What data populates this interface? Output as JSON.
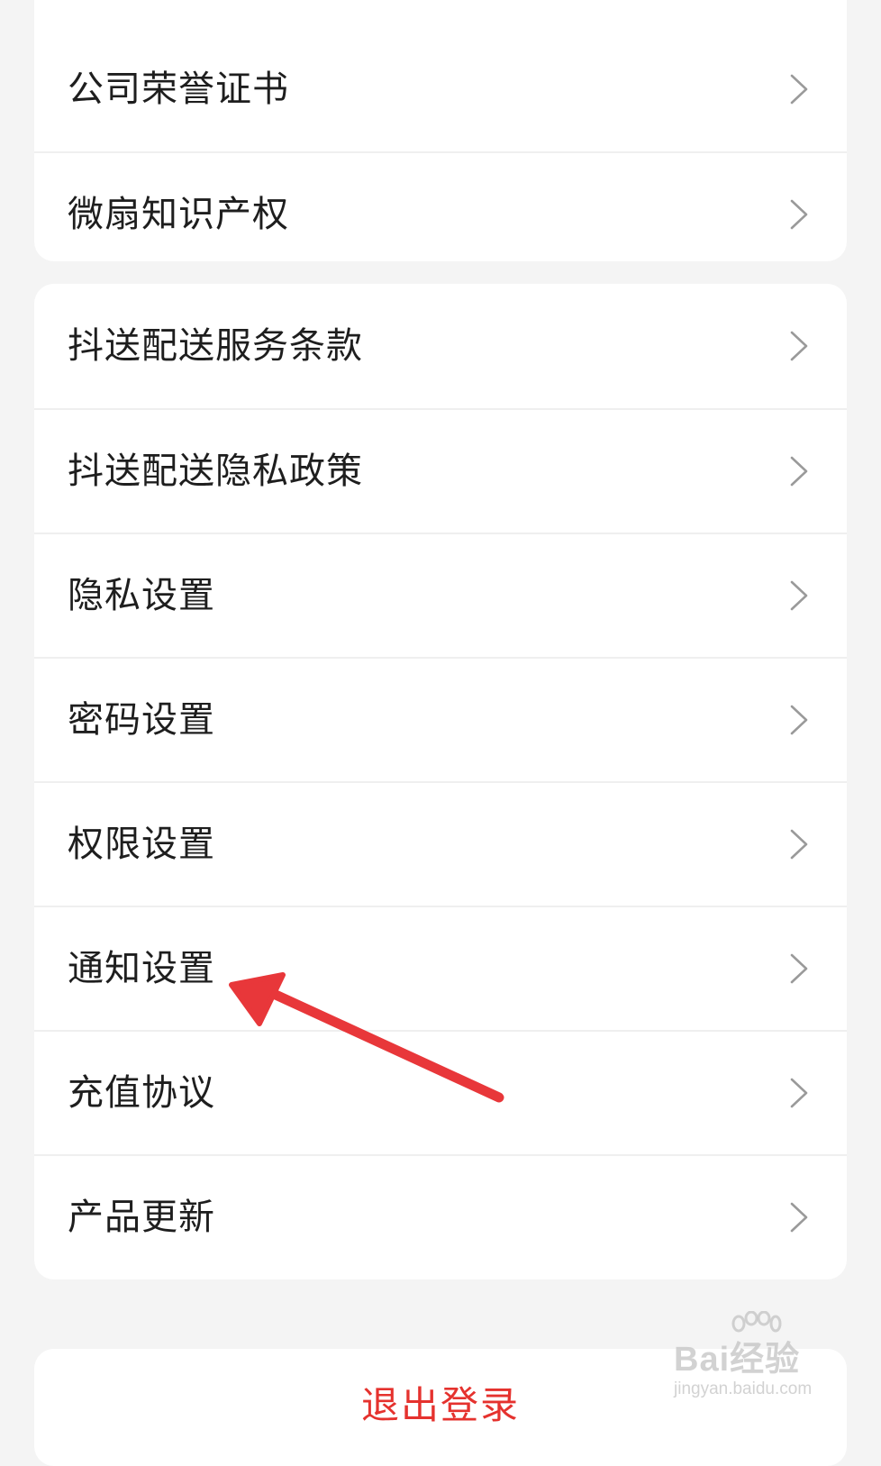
{
  "group_top": {
    "items": [
      {
        "label": "公司荣誉证书"
      },
      {
        "label": "微扇知识产权"
      }
    ]
  },
  "group_mid": {
    "items": [
      {
        "label": "抖送配送服务条款"
      },
      {
        "label": "抖送配送隐私政策"
      },
      {
        "label": "隐私设置"
      },
      {
        "label": "密码设置"
      },
      {
        "label": "权限设置"
      },
      {
        "label": "通知设置"
      },
      {
        "label": "充值协议"
      },
      {
        "label": "产品更新"
      }
    ]
  },
  "logout": {
    "label": "退出登录"
  },
  "watermark": {
    "brand": "Bai经验",
    "url": "jingyan.baidu.com"
  },
  "colors": {
    "background": "#f4f4f4",
    "card": "#ffffff",
    "logout_text": "#e5322e",
    "annotation_arrow": "#e8373a",
    "chevron": "#9a9a9a"
  },
  "icons": {
    "row_chevron": "chevron-right-icon",
    "annotation": "red-arrow-annotation"
  }
}
